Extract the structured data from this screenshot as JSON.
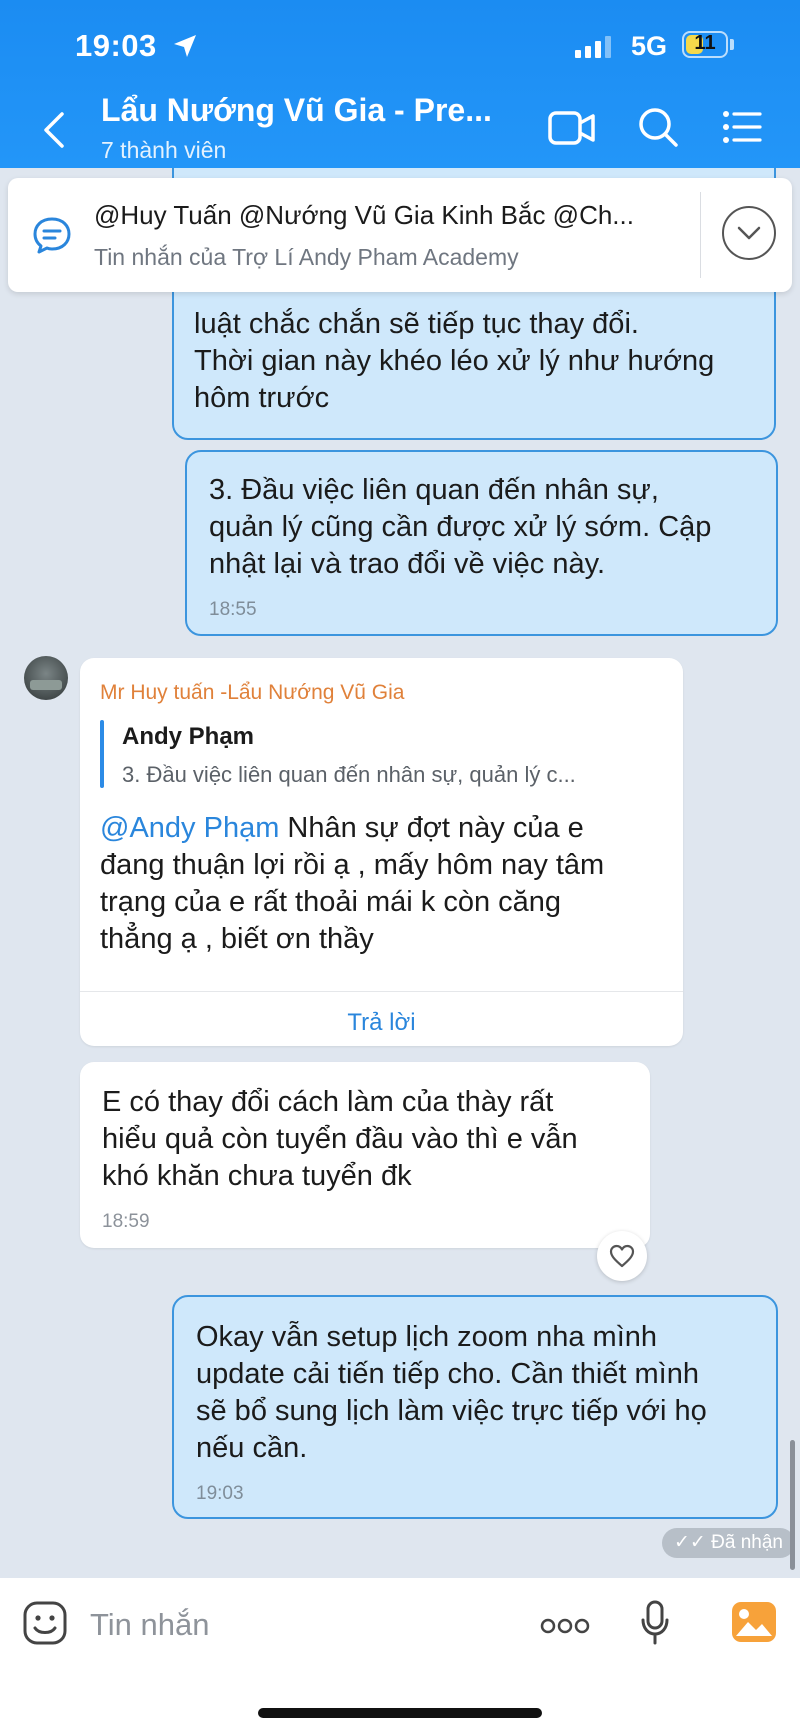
{
  "status_bar": {
    "time": "19:03",
    "network": "5G",
    "battery": "11",
    "battery_level": 0.11
  },
  "header": {
    "title": "Lẩu Nướng Vũ Gia - Pre...",
    "subtitle": "7 thành viên"
  },
  "pinned": {
    "title": "@Huy Tuấn @Nướng Vũ Gia Kinh Bắc @Ch...",
    "subtitle": "Tin nhắn của Trợ Lí Andy Pham Academy"
  },
  "messages": {
    "m1_visible": {
      "line1": "luật chắc chắn sẽ tiếp tục thay đổi.",
      "line2": "Thời gian này khéo léo xử lý như hướng",
      "line3": "hôm trước"
    },
    "m2": {
      "line1": "3. Đầu việc liên quan đến nhân sự,",
      "line2": "quản lý cũng cần được xử lý sớm. Cập",
      "line3": "nhật lại và trao đổi về việc này.",
      "time": "18:55"
    },
    "m3": {
      "sender": "Mr Huy tuấn -Lẩu Nướng Vũ Gia",
      "quote_name": "Andy Phạm",
      "quote_text": "3. Đầu việc liên quan đến nhân sự, quản lý c...",
      "mention": "@Andy Phạm",
      "line1": " Nhân sự đợt này  của e",
      "line2": "đang thuận lợi rồi ạ ,  mấy hôm nay tâm",
      "line3": "trạng của e rất thoải mái k còn căng",
      "line4": "thẳng ạ , biết ơn thầy",
      "reply_label": "Trả lời"
    },
    "m4": {
      "line1": "E có thay đổi cách làm của thày rất",
      "line2": "hiểu quả còn tuyển đầu vào thì e vẫn",
      "line3": "khó khăn chưa tuyển đk",
      "time": "18:59"
    },
    "m5": {
      "line1": "Okay vẫn setup lịch zoom nha mình",
      "line2": "update cải tiến tiếp cho. Cần thiết mình",
      "line3": "sẽ bổ sung lịch làm việc trực tiếp với họ",
      "line4": "nếu cần.",
      "time": "19:03"
    },
    "received_label": "Đã nhận"
  },
  "composer": {
    "placeholder": "Tin nhắn"
  },
  "colors": {
    "header_blue": "#1b8cf2",
    "my_bubble": "#cfe8fb",
    "my_border": "#3c95de",
    "sender_orange": "#e0813a",
    "link_blue": "#2a86dc"
  }
}
